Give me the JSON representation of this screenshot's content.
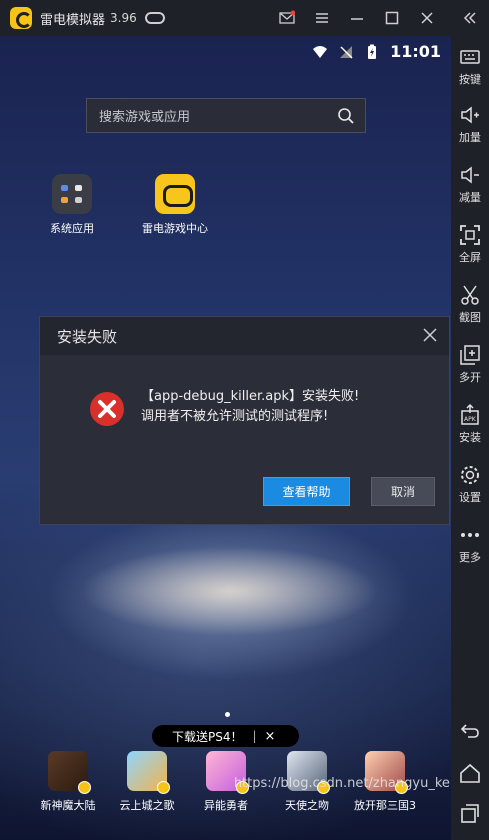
{
  "titlebar": {
    "app_name": "雷电模拟器",
    "version": "3.96"
  },
  "status": {
    "time": "11:01"
  },
  "search": {
    "placeholder": "搜索游戏或应用"
  },
  "desktop_apps": [
    {
      "label": "系统应用"
    },
    {
      "label": "雷电游戏中心"
    }
  ],
  "dialog": {
    "title": "安装失败",
    "message_line1": "【app-debug_killer.apk】安装失败!",
    "message_line2": "调用者不被允许测试的测试程序!",
    "help_button": "查看帮助",
    "cancel_button": "取消"
  },
  "promo": {
    "text": "下载送PS4！",
    "separator": "|",
    "close": "×"
  },
  "dock": [
    {
      "label": "新神魔大陆"
    },
    {
      "label": "云上城之歌"
    },
    {
      "label": "异能勇者"
    },
    {
      "label": "天使之吻"
    },
    {
      "label": "放开那三国3"
    }
  ],
  "watermark": "https://blog.csdn.net/zhangyu_kenshin",
  "sidebar": {
    "keys": "按键",
    "vol_up": "加量",
    "vol_down": "减量",
    "fullscreen": "全屏",
    "screenshot": "截图",
    "multi": "多开",
    "install": "安装",
    "settings": "设置",
    "more": "更多"
  },
  "colors": {
    "accent": "#1a8be0",
    "error": "#d9302c",
    "brand": "#f6c417"
  }
}
